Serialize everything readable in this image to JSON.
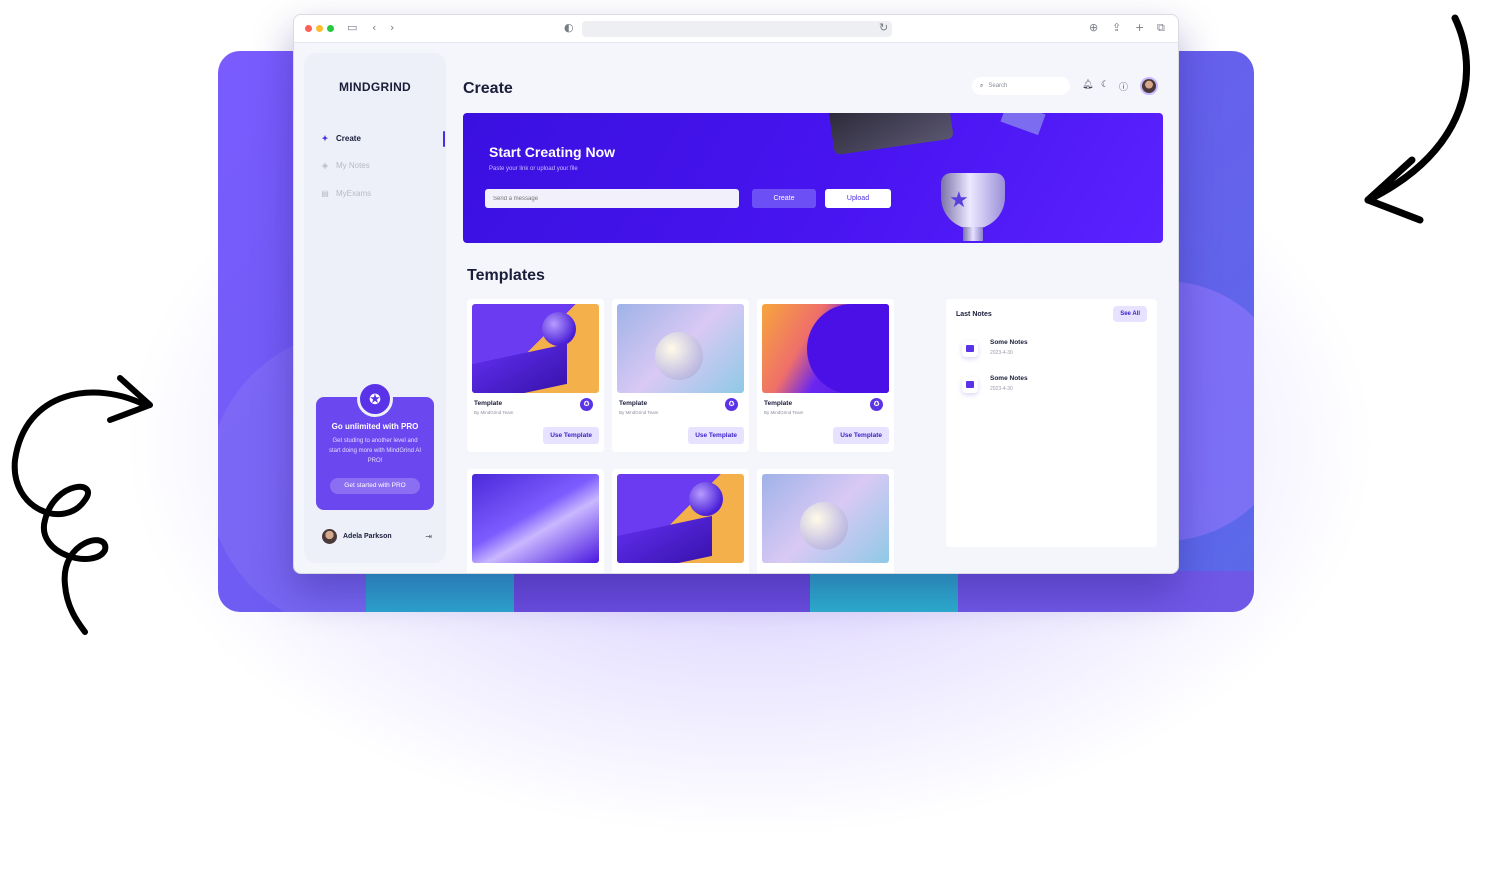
{
  "app": {
    "name": "MINDGRIND"
  },
  "sidebar": {
    "items": [
      {
        "label": "Create",
        "icon": "sparkle-icon",
        "active": true
      },
      {
        "label": "My Notes",
        "icon": "layers-icon",
        "active": false
      },
      {
        "label": "MyExams",
        "icon": "document-icon",
        "active": false
      }
    ],
    "promo": {
      "title": "Go unlimited with PRO",
      "text": "Get studing to another level and start doing more with MindGrind AI PRO!",
      "button": "Get started with PRO"
    },
    "user": {
      "name": "Adela Parkson"
    }
  },
  "header": {
    "title": "Create",
    "search_placeholder": "Search"
  },
  "hero": {
    "title": "Start Creating Now",
    "subtitle": "Paste your link or upload your file",
    "input_placeholder": "Send a message",
    "create_button": "Create",
    "upload_button": "Upload"
  },
  "templates": {
    "title": "Templates",
    "cards": [
      {
        "name": "Template",
        "by": "By MindGrind Team",
        "button": "Use Template"
      },
      {
        "name": "Template",
        "by": "By MindGrind Team",
        "button": "Use Template"
      },
      {
        "name": "Template",
        "by": "By MindGrind Team",
        "button": "Use Template"
      }
    ]
  },
  "last_notes": {
    "title": "Last Notes",
    "see_all": "See All",
    "items": [
      {
        "title": "Some Notes",
        "date": "2023-4-30"
      },
      {
        "title": "Some Notes",
        "date": "2023-4-30"
      }
    ]
  },
  "colors": {
    "accent": "#4a2de0",
    "hero_bg": "#4814f0",
    "stage_bg": "#7a5cff"
  }
}
